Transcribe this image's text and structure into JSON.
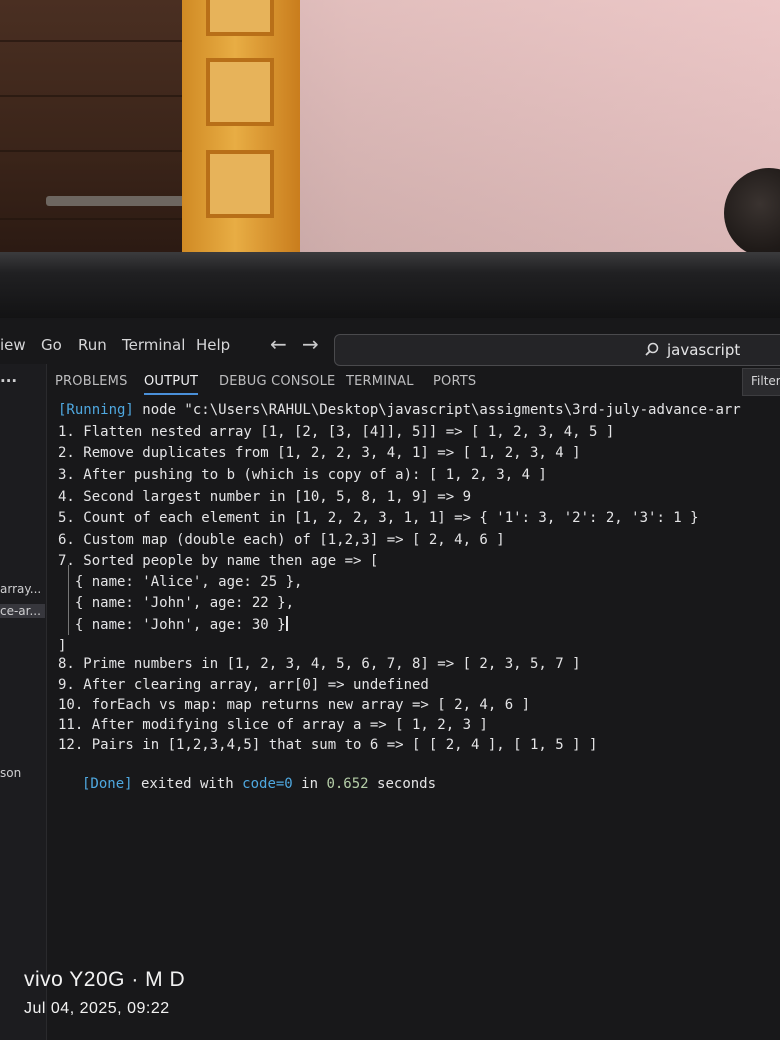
{
  "menu": [
    "iew",
    "Go",
    "Run",
    "Terminal",
    "Help"
  ],
  "search": {
    "text": "javascript"
  },
  "activity": {
    "dots": "···"
  },
  "sidebar": {
    "items": [
      "array...",
      "ce-ar...",
      "son"
    ]
  },
  "panel": {
    "tabs": [
      "PROBLEMS",
      "OUTPUT",
      "DEBUG CONSOLE",
      "TERMINAL",
      "PORTS"
    ],
    "active_tab": "OUTPUT",
    "filter": "Filter"
  },
  "output": {
    "running_tag": "[Running]",
    "running_cmd": " node \"c:\\Users\\RAHUL\\Desktop\\javascript\\assigments\\3rd-july-advance-arr",
    "lines": [
      "1. Flatten nested array [1, [2, [3, [4]], 5]] => [ 1, 2, 3, 4, 5 ]",
      "2. Remove duplicates from [1, 2, 2, 3, 4, 1] => [ 1, 2, 3, 4 ]",
      "3. After pushing to b (which is copy of a): [ 1, 2, 3, 4 ]",
      "4. Second largest number in [10, 5, 8, 1, 9] => 9",
      "5. Count of each element in [1, 2, 2, 3, 1, 1] => { '1': 3, '2': 2, '3': 1 }",
      "6. Custom map (double each) of [1,2,3] => [ 2, 4, 6 ]",
      "7. Sorted people by name then age => [",
      "  { name: 'Alice', age: 25 },",
      "  { name: 'John', age: 22 },",
      "  { name: 'John', age: 30 }",
      "]",
      "8. Prime numbers in [1, 2, 3, 4, 5, 6, 7, 8] => [ 2, 3, 5, 7 ]",
      "9. After clearing array, arr[0] => undefined",
      "10. forEach vs map: map returns new array => [ 2, 4, 6 ]",
      "11. After modifying slice of array a => [ 1, 2, 3 ]",
      "12. Pairs in [1,2,3,4,5] that sum to 6 => [ [ 2, 4 ], [ 1, 5 ] ]"
    ],
    "done_tag": "[Done]",
    "done_text_1": " exited with ",
    "done_code": "code=0",
    "done_text_2": " in ",
    "done_time": "0.652",
    "done_text_3": " seconds"
  },
  "watermark": {
    "device": "vivo Y20G · M D",
    "timestamp": "Jul 04, 2025, 09:22"
  },
  "colors": {
    "accent": "#4fa8e0",
    "tab_underline": "#4a90d9",
    "background": "#18181a"
  }
}
